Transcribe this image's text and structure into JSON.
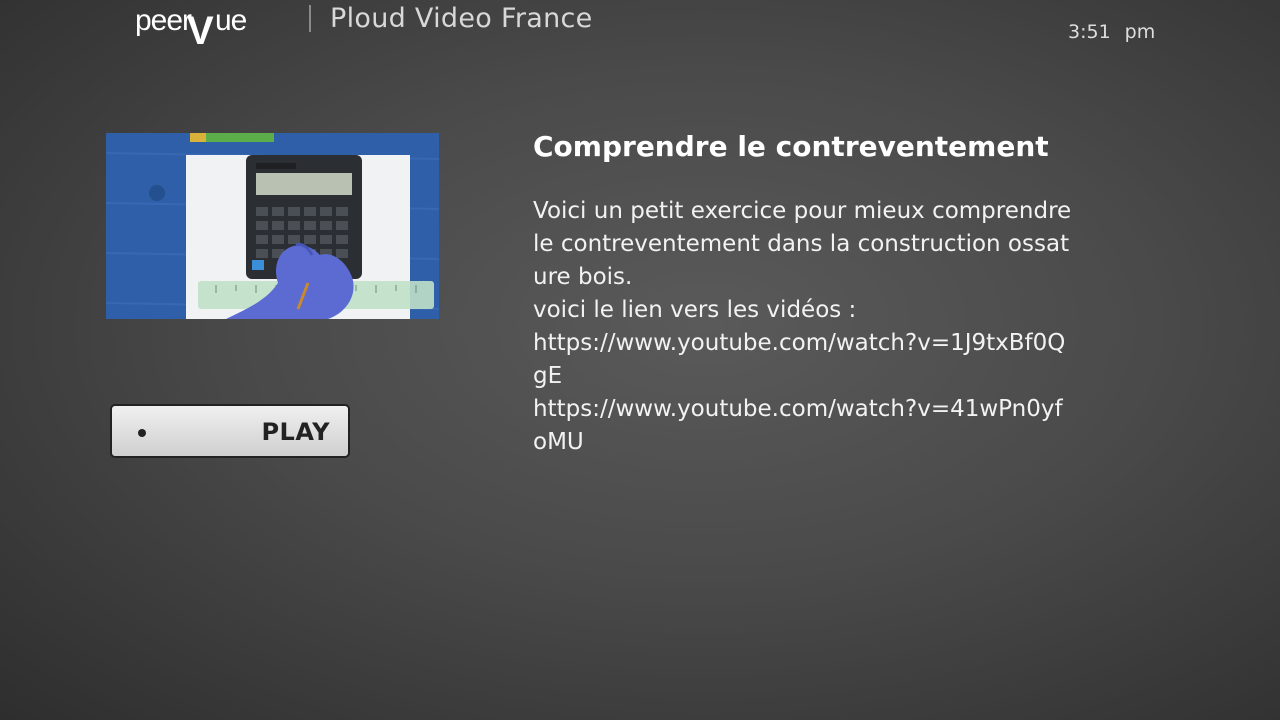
{
  "header": {
    "logo_text": "peerVue",
    "channel_title": "Ploud Video France",
    "clock": {
      "time": "3:51",
      "period": "pm"
    }
  },
  "video": {
    "title": "Comprendre le contreventement",
    "description": "Voici un petit exercice pour mieux comprendre le contreventement dans la construction ossature bois.\nvoici le lien vers les vidéos :\nhttps://www.youtube.com/watch?v=1J9txBf0QgE\nhttps://www.youtube.com/watch?v=41wPn0yfoMU",
    "thumbnail_subject": "calculator-on-blue-desk"
  },
  "actions": {
    "play_label": "PLAY"
  },
  "colors": {
    "background": "#4a4a4a",
    "text_primary": "#ffffff",
    "button_fill": "#e0e0e0",
    "button_text": "#222222",
    "thumbnail_desk": "#2f5fa8"
  }
}
